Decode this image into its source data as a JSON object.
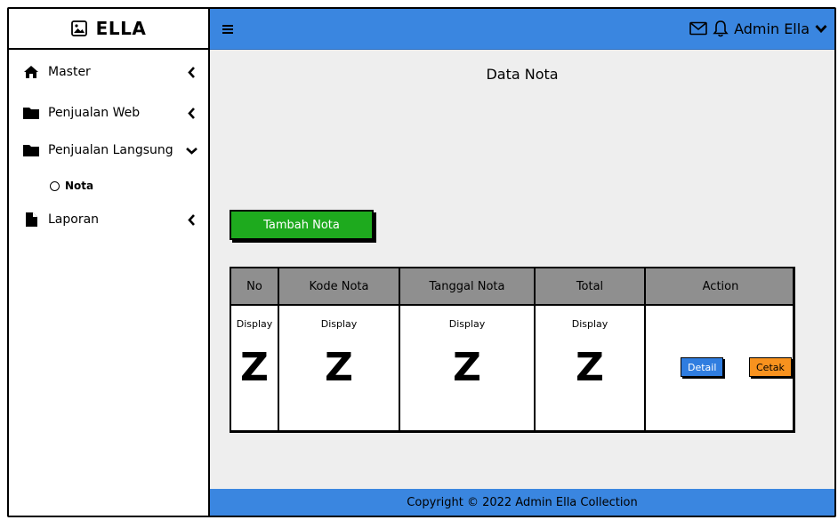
{
  "brand": {
    "title": "ELLA",
    "icon": "image-icon"
  },
  "sidebar": {
    "items": [
      {
        "label": "Master",
        "icon": "home-icon",
        "chevron": "left"
      },
      {
        "label": "Penjualan Web",
        "icon": "folder-icon",
        "chevron": "left"
      },
      {
        "label": "Penjualan Langsung",
        "icon": "folder-icon",
        "chevron": "down"
      },
      {
        "label": "Laporan",
        "icon": "file-icon",
        "chevron": "left"
      }
    ],
    "subitem": {
      "label": "Nota",
      "icon": "radio-icon"
    }
  },
  "topbar": {
    "user": "Admin Ella",
    "colors": {
      "accent": "#3a86e0"
    }
  },
  "main": {
    "title": "Data Nota",
    "add_button": "Tambah Nota",
    "table": {
      "headers": [
        "No",
        "Kode Nota",
        "Tanggal Nota",
        "Total",
        "Action"
      ],
      "row": {
        "display": "Display",
        "placeholder": "Z",
        "detail_button": "Detail",
        "cetak_button": "Cetak"
      }
    }
  },
  "footer": {
    "text": "Copyright © 2022 Admin Ella Collection"
  }
}
